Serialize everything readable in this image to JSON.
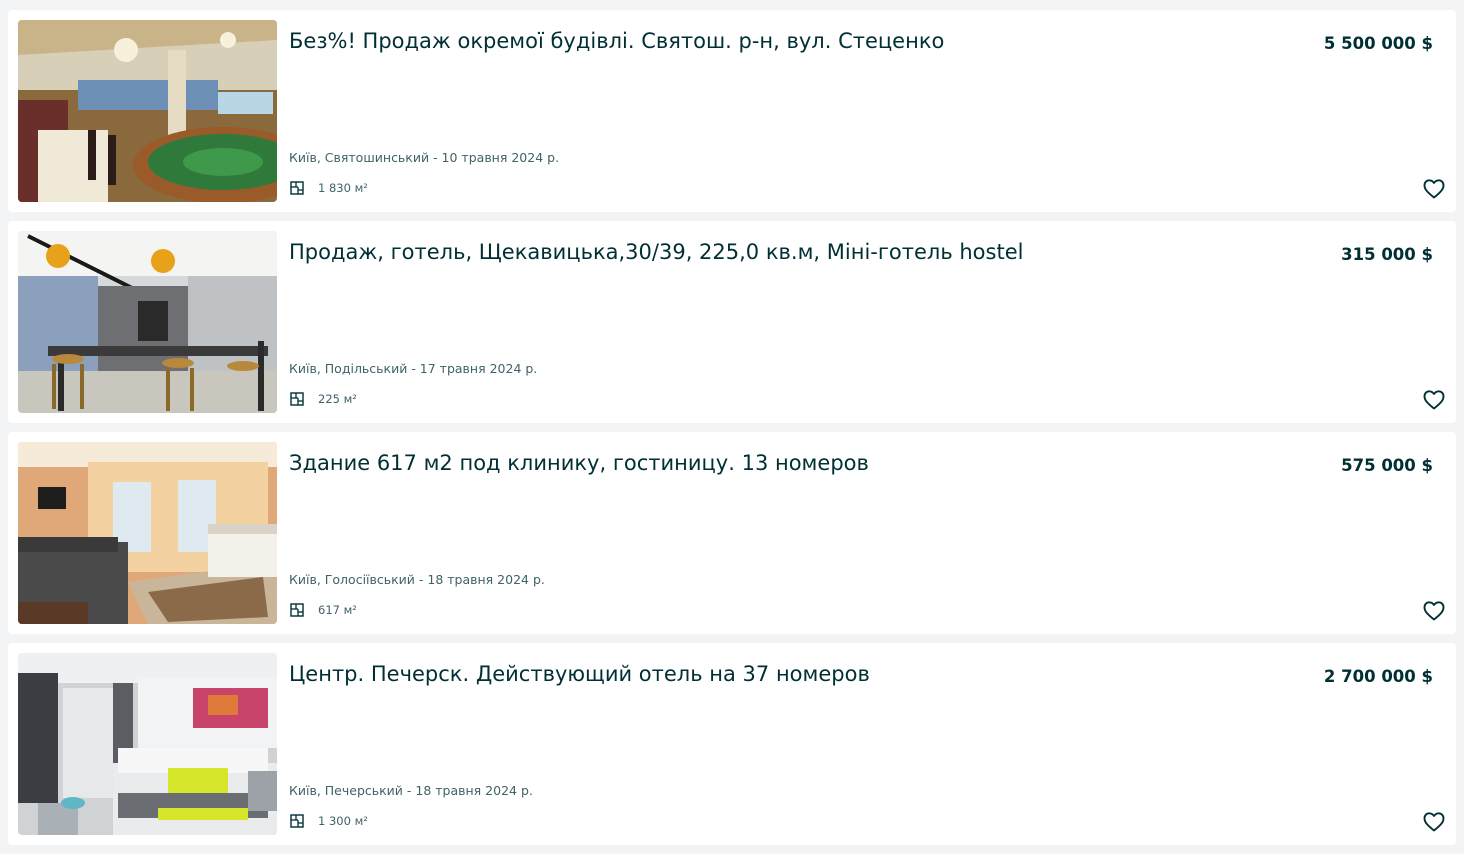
{
  "listings": [
    {
      "title": "Без%! Продаж окремої будівлі. Святош. р-н, вул. Стеценко",
      "price": "5 500 000 $",
      "location_date": "Київ, Святошинський - 10 травня 2024 р.",
      "area": "1 830 м²",
      "image": "banquet-hall-photo"
    },
    {
      "title": "Продаж, готель, Щекавицька,30/39, 225,0 кв.м, Міні-готель hostel",
      "price": "315 000 $",
      "location_date": "Київ, Подільський - 17 травня 2024 р.",
      "area": "225 м²",
      "image": "kitchen-bar-photo"
    },
    {
      "title": "Здание 617 м2 под клинику, гостиницу. 13 номеров",
      "price": "575 000 $",
      "location_date": "Київ, Голосіївський - 18 травня 2024 р.",
      "area": "617 м²",
      "image": "bedroom-orange-photo"
    },
    {
      "title": "Центр. Печерск. Действующий отель на 37 номеров",
      "price": "2 700 000 $",
      "location_date": "Київ, Печерський - 18 травня 2024 р.",
      "area": "1 300 м²",
      "image": "hotel-room-photo"
    }
  ],
  "icons": {
    "area": "floor-plan-icon",
    "favorite": "heart-outline-icon"
  },
  "colors": {
    "text_primary": "#002f34",
    "text_secondary": "#406367",
    "background": "#f2f4f5",
    "card": "#ffffff"
  }
}
